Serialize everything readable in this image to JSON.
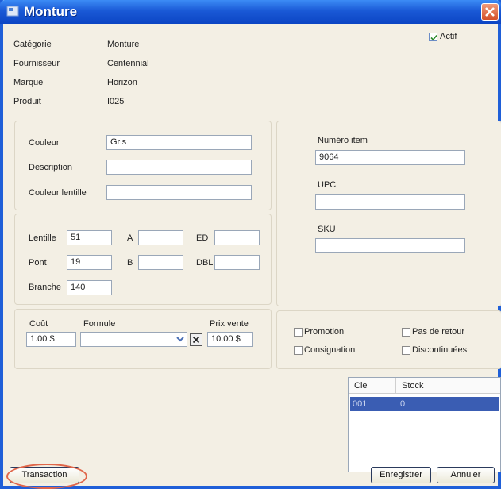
{
  "window": {
    "title": "Monture"
  },
  "info": [
    {
      "label": "Catégorie",
      "value": "Monture"
    },
    {
      "label": "Fournisseur",
      "value": "Centennial"
    },
    {
      "label": "Marque",
      "value": "Horizon"
    },
    {
      "label": "Produit",
      "value": "I025"
    }
  ],
  "actif": {
    "label": "Actif",
    "checked": true
  },
  "color_panel": {
    "couleur": {
      "label": "Couleur",
      "value": "Gris"
    },
    "description": {
      "label": "Description",
      "value": ""
    },
    "couleur_lentille": {
      "label": "Couleur lentille",
      "value": ""
    }
  },
  "measures": {
    "lentille": {
      "label": "Lentille",
      "value": "51"
    },
    "a": {
      "label": "A",
      "value": ""
    },
    "ed": {
      "label": "ED",
      "value": ""
    },
    "pont": {
      "label": "Pont",
      "value": "19"
    },
    "b": {
      "label": "B",
      "value": ""
    },
    "dbl": {
      "label": "DBL",
      "value": ""
    },
    "branche": {
      "label": "Branche",
      "value": "140"
    }
  },
  "pricing": {
    "cout": {
      "label": "Coût",
      "value": "1.00 $"
    },
    "formule": {
      "label": "Formule",
      "value": ""
    },
    "prix_vente": {
      "label": "Prix vente",
      "value": "10.00 $"
    }
  },
  "ids": {
    "numero_item": {
      "label": "Numéro item",
      "value": "9064"
    },
    "upc": {
      "label": "UPC",
      "value": ""
    },
    "sku": {
      "label": "SKU",
      "value": ""
    }
  },
  "flags": {
    "promotion": {
      "label": "Promotion",
      "checked": false
    },
    "pas_de_retour": {
      "label": "Pas de retour",
      "checked": false
    },
    "consignation": {
      "label": "Consignation",
      "checked": false
    },
    "discontinuees": {
      "label": "Discontinuées",
      "checked": false
    }
  },
  "stock_table": {
    "headers": [
      "Cie",
      "Stock"
    ],
    "rows": [
      {
        "cie": "001",
        "stock": "0"
      }
    ]
  },
  "buttons": {
    "transaction": "Transaction",
    "enregistrer": "Enregistrer",
    "annuler": "Annuler"
  },
  "colors": {
    "titlebar": "#1a59d6",
    "selection": "#3a5db3",
    "highlight": "#e0664a"
  }
}
